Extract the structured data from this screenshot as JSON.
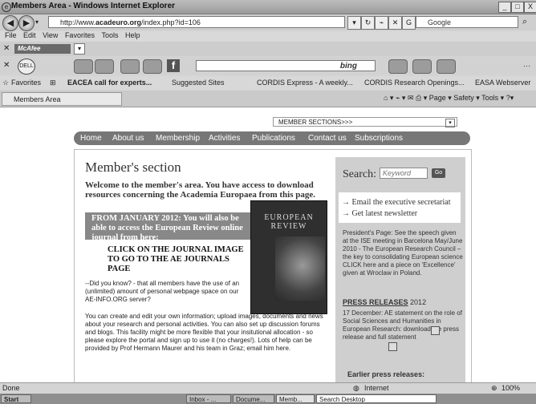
{
  "window": {
    "title": "Members Area - Windows Internet Explorer",
    "controls": [
      "_",
      "□",
      "X"
    ]
  },
  "address": {
    "prefix": "http://www.",
    "domain": "acadeuro.org",
    "path": "/index.php?id=106",
    "search_label": "Google"
  },
  "menu": [
    "File",
    "Edit",
    "View",
    "Favorites",
    "Tools",
    "Help"
  ],
  "mcafee": {
    "label": "McAfee"
  },
  "toolbar": {
    "dell": "DELL",
    "bing": "bing"
  },
  "favorites": {
    "label": "Favorites",
    "items": [
      "EACEA call for experts...",
      "Suggested Sites",
      "CORDIS Express - A weekly...",
      "CORDIS Research Openings...",
      "EASA Webserver"
    ]
  },
  "tab": {
    "title": "Members Area",
    "tools": "Page ▾   Safety ▾   Tools ▾"
  },
  "page": {
    "member_select": "MEMBER SECTIONS>>>",
    "nav": [
      "Home",
      "About us",
      "Membership",
      "Activities",
      "Publications",
      "Contact us",
      "Subscriptions"
    ],
    "heading": "Member's section",
    "intro": "Welcome to the member's area. You have access to download resources concerning the Academia Europaea from this page.",
    "gray_notice": "FROM JANUARY 2012: You will also be able to access the European Review online journal from here:",
    "click_text": "CLICK ON THE JOURNAL IMAGE TO GO TO THE AE JOURNALS PAGE",
    "journal_title": "EUROPEAN REVIEW",
    "dyk_bold": "Did you know?",
    "dyk_text": "--Did you know? - that all members have the use of an (unlimited) amount of personal webpage space on our AE-INFO.ORG server?",
    "create_text": "You can create and edit your own information; upload images, documents and news about your research and personal activities. You can also set up discussion forums and blogs. This facility might be more flexible that your insitutional allocation - so please explore the portal and sign up to use it (no charges!). Lots of help can be provided by Prof Hermann Maurer and his team in Graz; email him here."
  },
  "sidebar": {
    "search_label": "Search:",
    "keyword_placeholder": "Keyword",
    "go_label": "Go",
    "links": [
      "Email the executive secretariat",
      "Get latest newsletter"
    ],
    "president": "President's Page: See the speech given at the ISE meeting in Barcelona May/June 2010 - The European Research Council – the key to consolidating European science CLICK here and a piece on 'Excellence' given at Wroclaw in Poland.",
    "press_title": "PRESS RELEASES",
    "press_year": "2012",
    "december": "17 December: AE statement on the role of Social Sciences and Humanities in European Research: download the press release and full statement",
    "earlier": "Earlier press releases:"
  },
  "status": {
    "left": "Done",
    "zone": "Internet",
    "zoom": "100%"
  },
  "taskbar": {
    "start": "Start",
    "items": [
      "Inbox - ...",
      "Docume...",
      "Memb...",
      "Search Desktop"
    ]
  }
}
